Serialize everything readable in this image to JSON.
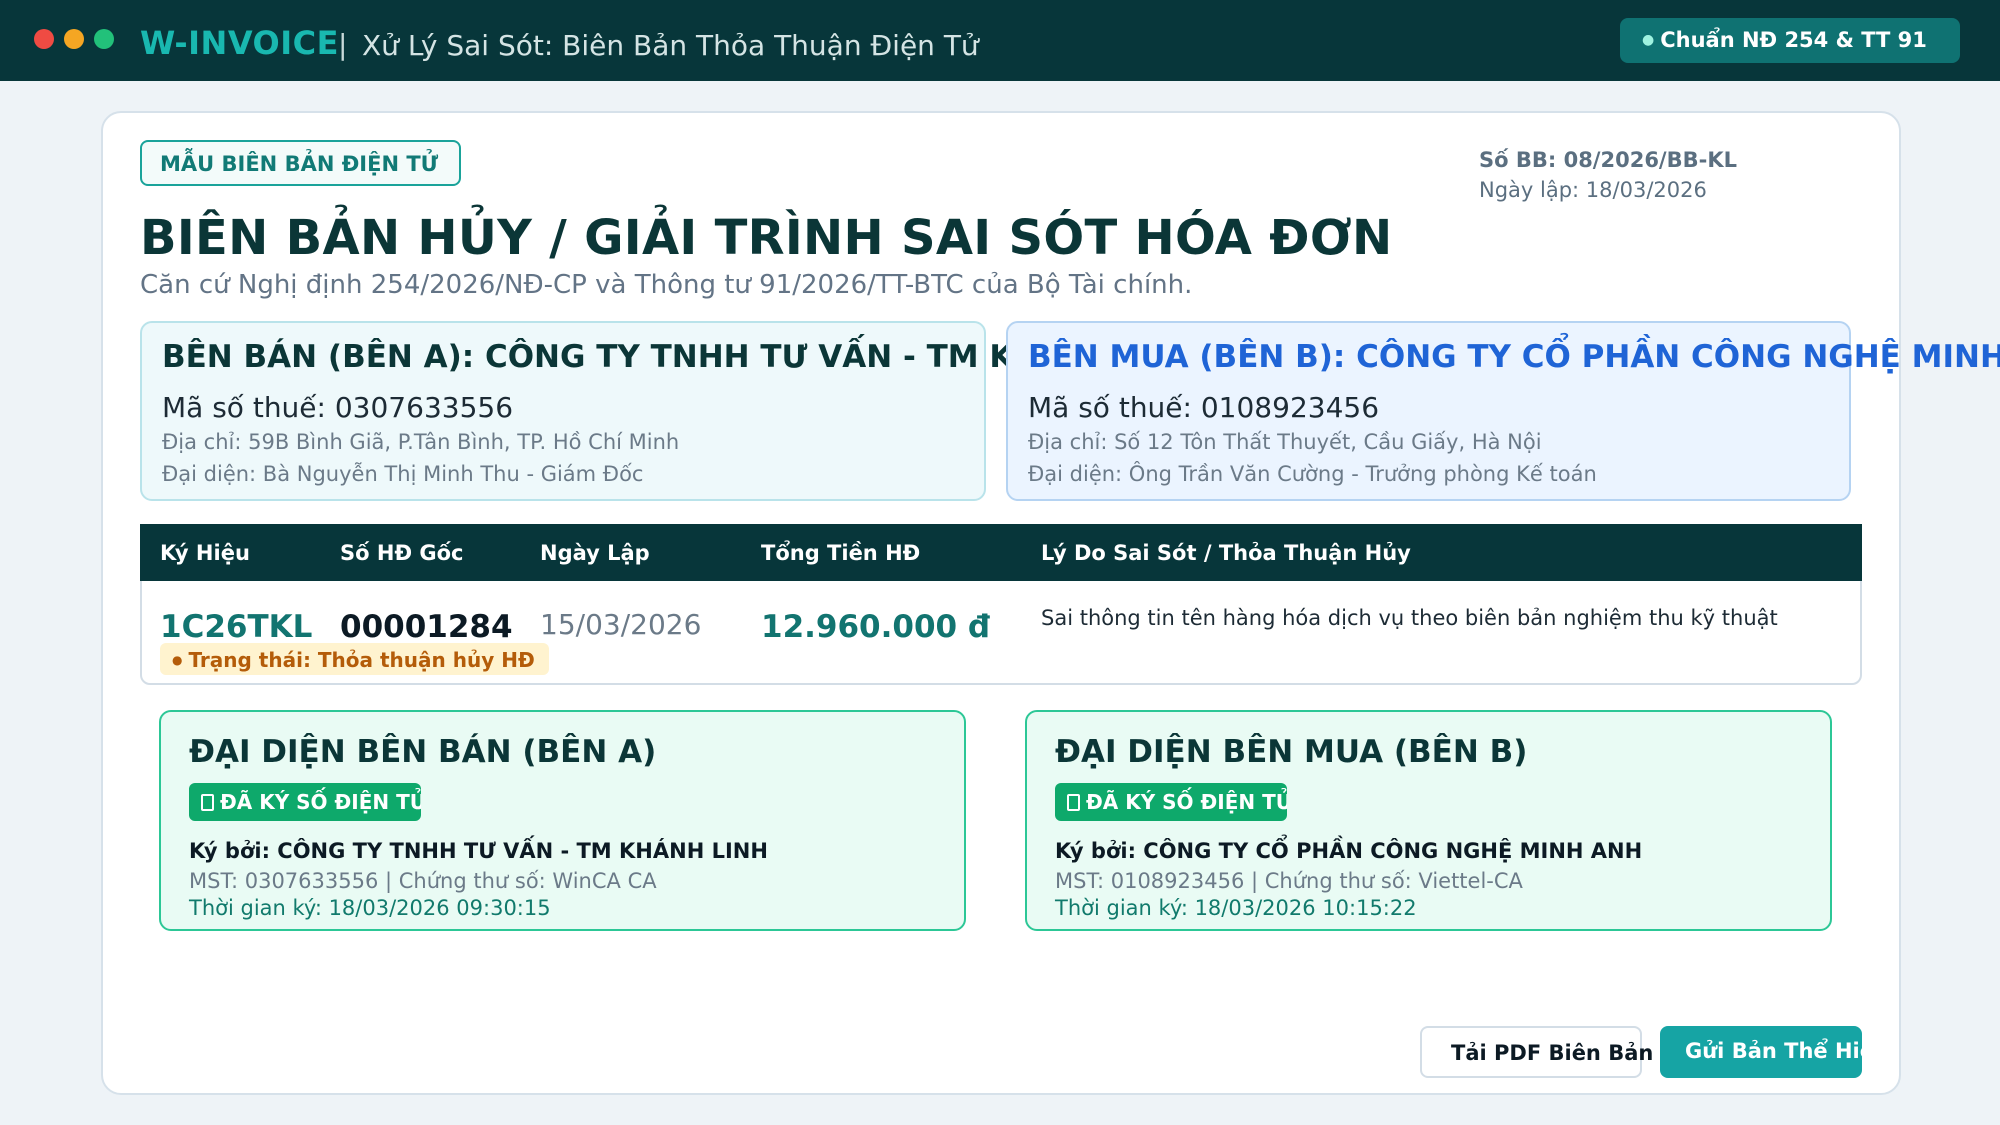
{
  "window": {
    "brand": "W-INVOICE",
    "separator": "|",
    "title": "Xử Lý Sai Sót: Biên Bản Thỏa Thuận Điện Tử",
    "standard_badge": "Chuẩn NĐ 254 & TT 91"
  },
  "document": {
    "template_tag": "MẪU BIÊN BẢN ĐIỆN TỬ",
    "number": "Số BB: 08/2026/BB-KL",
    "created_date": "Ngày lập: 18/03/2026",
    "title": "BIÊN BẢN HỦY / GIẢI TRÌNH SAI SÓT HÓA ĐƠN",
    "subtitle": "Căn cứ Nghị định 254/2026/NĐ-CP và Thông tư 91/2026/TT-BTC của Bộ Tài chính."
  },
  "parties": {
    "seller": {
      "title": "BÊN BÁN (BÊN A): CÔNG TY TNHH TƯ VẤN - TM KHÁNH LINH",
      "tax_code": "Mã số thuế: 0307633556",
      "address": "Địa chỉ: 59B Bình Giã, P.Tân Bình, TP. Hồ Chí Minh",
      "representative": "Đại diện: Bà Nguyễn Thị Minh Thu - Giám Đốc"
    },
    "buyer": {
      "title": "BÊN MUA (BÊN B): CÔNG TY CỔ PHẦN CÔNG NGHỆ MINH ANH",
      "tax_code": "Mã số thuế: 0108923456",
      "address": "Địa chỉ: Số 12 Tôn Thất Thuyết, Cầu Giấy, Hà Nội",
      "representative": "Đại diện: Ông Trần Văn Cường - Trưởng phòng Kế toán"
    }
  },
  "table": {
    "headers": [
      "Ký Hiệu",
      "Số HĐ Gốc",
      "Ngày Lập",
      "Tổng Tiền HĐ",
      "Lý Do Sai Sót / Thỏa Thuận Hủy"
    ],
    "row": {
      "code": "1C26TKL",
      "number": "00001284",
      "date": "15/03/2026",
      "amount": "12.960.000 đ",
      "reason": "Sai thông tin tên hàng hóa dịch vụ theo biên bản nghiệm thu kỹ thuật",
      "status": "Trạng thái: Thỏa thuận hủy HĐ"
    }
  },
  "signatures": {
    "seller": {
      "title": "ĐẠI DIỆN BÊN BÁN (BÊN A)",
      "badge": "ĐÃ KÝ SỐ ĐIỆN TỬ",
      "signed_by": "Ký bởi: CÔNG TY TNHH TƯ VẤN - TM KHÁNH LINH",
      "cert": "MST: 0307633556 | Chứng thư số: WinCA CA",
      "time": "Thời gian ký: 18/03/2026 09:30:15"
    },
    "buyer": {
      "title": "ĐẠI DIỆN BÊN MUA (BÊN B)",
      "badge": "ĐÃ KÝ SỐ ĐIỆN TỬ",
      "signed_by": "Ký bởi: CÔNG TY CỔ PHẦN CÔNG NGHỆ MINH ANH",
      "cert": "MST: 0108923456 | Chứng thư số: Viettel-CA",
      "time": "Thời gian ký: 18/03/2026 10:15:22"
    }
  },
  "actions": {
    "download_pdf": "Tải PDF Biên Bản",
    "send": "Gửi Bản Thể Hiện"
  },
  "colors": {
    "header_bg": "#07363a",
    "brand": "#19b8b0",
    "buyer_accent": "#1f64d6",
    "signed_green": "#0ea96b",
    "status_bg": "#fff3cf"
  }
}
